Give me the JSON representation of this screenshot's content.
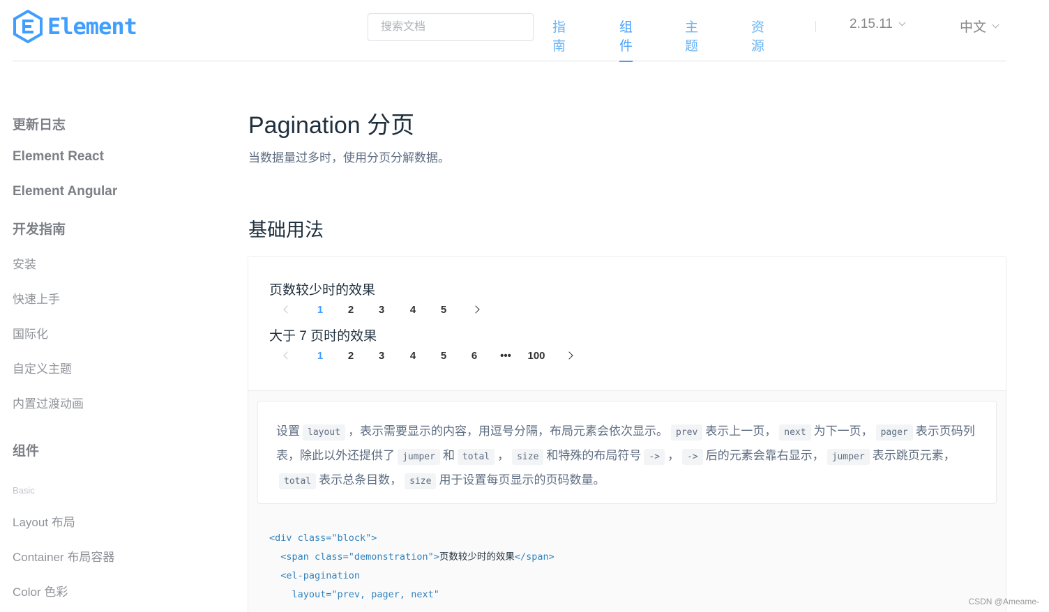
{
  "header": {
    "logo_text": "Element",
    "search_placeholder": "搜索文档",
    "nav": [
      "指南",
      "组件",
      "主题",
      "资源"
    ],
    "active_nav": "组件",
    "version": "2.15.11",
    "language": "中文"
  },
  "sidebar": {
    "groups": {
      "changelog": "更新日志",
      "react": "Element React",
      "angular": "Element Angular",
      "guide": "开发指南",
      "components": "组件"
    },
    "guide_items": [
      "安装",
      "快速上手",
      "国际化",
      "自定义主题",
      "内置过渡动画"
    ],
    "category_basic": "Basic",
    "component_items": [
      "Layout 布局",
      "Container 布局容器",
      "Color 色彩"
    ]
  },
  "main": {
    "title": "Pagination 分页",
    "subtitle": "当数据量过多时，使用分页分解数据。",
    "section_title": "基础用法",
    "demo": {
      "label_small": "页数较少时的效果",
      "pages_small": [
        "1",
        "2",
        "3",
        "4",
        "5"
      ],
      "label_large": "大于 7 页时的效果",
      "pages_large": [
        "1",
        "2",
        "3",
        "4",
        "5",
        "6",
        "•••",
        "100"
      ],
      "active_page": "1"
    },
    "description": {
      "t1": "设置",
      "c_layout": "layout",
      "t2": "，表示需要显示的内容，用逗号分隔，布局元素会依次显示。",
      "c_prev": "prev",
      "t3": "表示上一页，",
      "c_next": "next",
      "t4": "为下一页，",
      "c_pager": "pager",
      "t5": "表示页码列表，除此以外还提供了",
      "c_jumper": "jumper",
      "t6": "和",
      "c_total": "total",
      "t7": "，",
      "c_size": "size",
      "t8": "和特殊的布局符号",
      "c_arrow": "->",
      "t9": "，",
      "c_arrow2": "->",
      "t10": "后的元素会靠右显示，",
      "c_jumper2": "jumper",
      "t11": "表示跳页元素，",
      "c_total2": "total",
      "t12": "表示总条目数，",
      "c_size2": "size",
      "t13": "用于设置每页显示的页码数量。"
    },
    "code": {
      "l1": "<div class=\"block\">",
      "l2_open": "  <span class=\"demonstration\">",
      "l2_text": "页数较少时的效果",
      "l2_close": "</span>",
      "l3": "  <el-pagination",
      "l4": "    layout=\"prev, pager, next\""
    }
  },
  "watermark": "CSDN @Ameame-",
  "colors": {
    "accent": "#409eff",
    "text": "#1f2f3d",
    "muted": "#5e6d82"
  }
}
